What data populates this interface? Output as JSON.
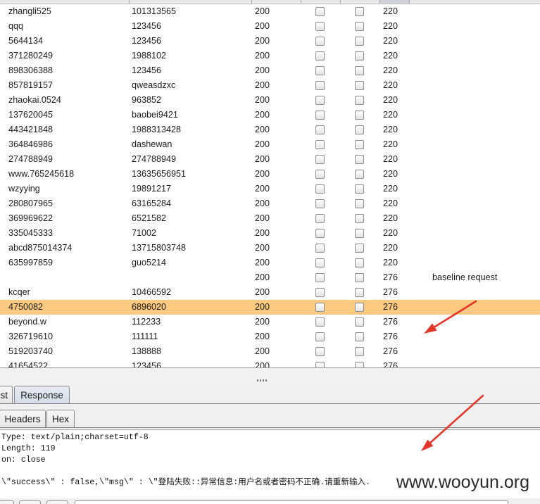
{
  "colors": {
    "selected_row": "#fbc97f",
    "annotation_arrow": "#e5372a",
    "sorted_column_header": "#cfd3d9"
  },
  "results_table": {
    "rows": [
      {
        "payload1": "zhangli525",
        "payload2": "101313565",
        "status": "200",
        "error": false,
        "timeout": false,
        "length": "220"
      },
      {
        "payload1": "qqq",
        "payload2": "123456",
        "status": "200",
        "error": false,
        "timeout": false,
        "length": "220"
      },
      {
        "payload1": "5644134",
        "payload2": "123456",
        "status": "200",
        "error": false,
        "timeout": false,
        "length": "220"
      },
      {
        "payload1": "371280249",
        "payload2": "1988102",
        "status": "200",
        "error": false,
        "timeout": false,
        "length": "220"
      },
      {
        "payload1": "898306388",
        "payload2": "123456",
        "status": "200",
        "error": false,
        "timeout": false,
        "length": "220"
      },
      {
        "payload1": "857819157",
        "payload2": "qweasdzxc",
        "status": "200",
        "error": false,
        "timeout": false,
        "length": "220"
      },
      {
        "payload1": "zhaokai.0524",
        "payload2": "963852",
        "status": "200",
        "error": false,
        "timeout": false,
        "length": "220"
      },
      {
        "payload1": "137620045",
        "payload2": "baobei9421",
        "status": "200",
        "error": false,
        "timeout": false,
        "length": "220"
      },
      {
        "payload1": "443421848",
        "payload2": "1988313428",
        "status": "200",
        "error": false,
        "timeout": false,
        "length": "220"
      },
      {
        "payload1": "364846986",
        "payload2": "dashewan",
        "status": "200",
        "error": false,
        "timeout": false,
        "length": "220"
      },
      {
        "payload1": "274788949",
        "payload2": "274788949",
        "status": "200",
        "error": false,
        "timeout": false,
        "length": "220"
      },
      {
        "payload1": "www.765245618",
        "payload2": "13635656951",
        "status": "200",
        "error": false,
        "timeout": false,
        "length": "220"
      },
      {
        "payload1": "wzyying",
        "payload2": "19891217",
        "status": "200",
        "error": false,
        "timeout": false,
        "length": "220"
      },
      {
        "payload1": "280807965",
        "payload2": "63165284",
        "status": "200",
        "error": false,
        "timeout": false,
        "length": "220"
      },
      {
        "payload1": "369969622",
        "payload2": "6521582",
        "status": "200",
        "error": false,
        "timeout": false,
        "length": "220"
      },
      {
        "payload1": "335045333",
        "payload2": "71002",
        "status": "200",
        "error": false,
        "timeout": false,
        "length": "220"
      },
      {
        "payload1": "abcd875014374",
        "payload2": "13715803748",
        "status": "200",
        "error": false,
        "timeout": false,
        "length": "220"
      },
      {
        "payload1": "635997859",
        "payload2": "guo5214",
        "status": "200",
        "error": false,
        "timeout": false,
        "length": "220"
      },
      {
        "payload1": "",
        "payload2": "",
        "status": "200",
        "error": false,
        "timeout": false,
        "length": "276",
        "comment": "baseline request"
      },
      {
        "payload1": "kcqer",
        "payload2": "10466592",
        "status": "200",
        "error": false,
        "timeout": false,
        "length": "276"
      },
      {
        "payload1": "4750082",
        "payload2": "6896020",
        "status": "200",
        "error": false,
        "timeout": false,
        "length": "276",
        "selected": true
      },
      {
        "payload1": "beyond.w",
        "payload2": "112233",
        "status": "200",
        "error": false,
        "timeout": false,
        "length": "276"
      },
      {
        "payload1": "326719610",
        "payload2": "111111",
        "status": "200",
        "error": false,
        "timeout": false,
        "length": "276"
      },
      {
        "payload1": "519203740",
        "payload2": "138888",
        "status": "200",
        "error": false,
        "timeout": false,
        "length": "276"
      },
      {
        "payload1": "41654522",
        "payload2": "123456",
        "status": "200",
        "error": false,
        "timeout": false,
        "length": "276"
      }
    ]
  },
  "message_tabs": [
    {
      "label": "st",
      "selected": false
    },
    {
      "label": "Response",
      "selected": true
    }
  ],
  "view_tabs": [
    {
      "label": "Headers"
    },
    {
      "label": "Hex"
    }
  ],
  "response": {
    "header_lines": [
      "Type: text/plain;charset=utf-8",
      "Length: 119",
      "on: close"
    ],
    "body": "\\\"success\\\" : false,\\\"msg\\\" : \\\"登陆失败::异常信息:用户名或者密码不正确.请重新输入."
  },
  "watermark": "www.wooyun.org"
}
